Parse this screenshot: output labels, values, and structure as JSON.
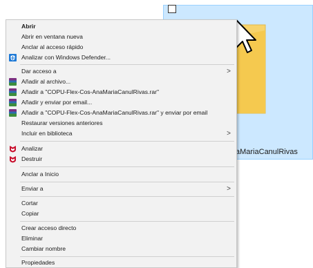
{
  "folder": {
    "name": "aMariaCanulRivas"
  },
  "menu": {
    "items": [
      {
        "label": "Abrir",
        "bold": true
      },
      {
        "label": "Abrir en ventana nueva"
      },
      {
        "label": "Anclar al acceso rápido"
      },
      {
        "label": "Analizar con Windows Defender...",
        "icon": "windows-defender-icon"
      },
      {
        "label": "Dar acceso a",
        "submenu": true
      },
      {
        "label": "Añadir al archivo...",
        "icon": "winrar-icon"
      },
      {
        "label": "Añadir a \"COPU-Flex-Cos-AnaMariaCanulRivas.rar\"",
        "icon": "winrar-icon"
      },
      {
        "label": "Añadir y enviar por email...",
        "icon": "winrar-icon"
      },
      {
        "label": "Añadir a \"COPU-Flex-Cos-AnaMariaCanulRivas.rar\" y enviar por email",
        "icon": "winrar-icon"
      },
      {
        "label": "Restaurar versiones anteriores"
      },
      {
        "label": "Incluir en biblioteca",
        "submenu": true
      },
      {
        "label": "Analizar",
        "icon": "mcafee-icon"
      },
      {
        "label": "Destruir",
        "icon": "mcafee-icon"
      },
      {
        "label": "Anclar a Inicio"
      },
      {
        "label": "Enviar a",
        "submenu": true
      },
      {
        "label": "Cortar"
      },
      {
        "label": "Copiar"
      },
      {
        "label": "Crear acceso directo"
      },
      {
        "label": "Eliminar"
      },
      {
        "label": "Cambiar nombre"
      },
      {
        "label": "Propiedades"
      }
    ],
    "submenu_arrow": ">"
  },
  "colors": {
    "selection": "#cce8ff",
    "folder": "#f7d36b",
    "mcafee": "#c8102e",
    "defender": "#1f7ad6"
  }
}
